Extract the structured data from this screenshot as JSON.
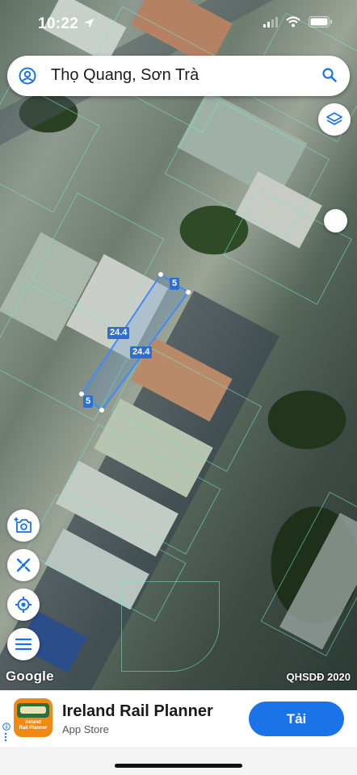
{
  "status_bar": {
    "time": "10:22"
  },
  "search": {
    "query": "Thọ Quang, Sơn Trà"
  },
  "measurement": {
    "long_side_a": "24.4",
    "long_side_b": "24.4",
    "short_side_a": "5",
    "short_side_b": "5"
  },
  "map": {
    "attribution": "Google",
    "layer_label": "QHSDĐ 2020"
  },
  "ad": {
    "app_name": "Ireland Rail Planner",
    "store": "App Store",
    "cta_label": "Tải",
    "icon_text_1": "Ireland",
    "icon_text_2": "Rail Planner"
  },
  "colors": {
    "accent": "#1a73e8",
    "boundary": "#78e6c8",
    "measure": "#2d6fd0"
  }
}
